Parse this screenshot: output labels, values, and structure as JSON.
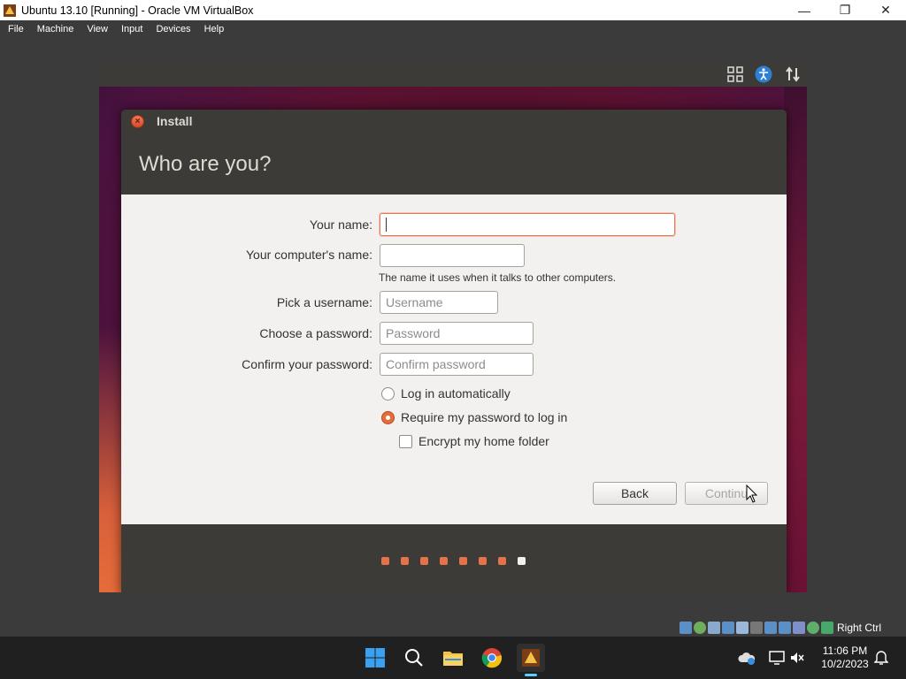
{
  "window": {
    "title": "Ubuntu 13.10 [Running] - Oracle VM VirtualBox",
    "minimize": "—",
    "maximize": "❐",
    "close": "✕"
  },
  "menu": [
    "File",
    "Machine",
    "View",
    "Input",
    "Devices",
    "Help"
  ],
  "dialog": {
    "window_title": "Install",
    "heading": "Who are you?",
    "fields": {
      "name": {
        "label": "Your name:",
        "value": ""
      },
      "computer": {
        "label": "Your computer's name:",
        "value": "",
        "hint": "The name it uses when it talks to other computers."
      },
      "username": {
        "label": "Pick a username:",
        "placeholder": "Username"
      },
      "password": {
        "label": "Choose a password:",
        "placeholder": "Password"
      },
      "confirm": {
        "label": "Confirm your password:",
        "placeholder": "Confirm password"
      }
    },
    "options": {
      "auto_login": {
        "label": "Log in automatically",
        "selected": false
      },
      "require_password": {
        "label": "Require my password to log in",
        "selected": true
      },
      "encrypt_home": {
        "label": "Encrypt my home folder",
        "checked": false
      }
    },
    "buttons": {
      "back": "Back",
      "continue": "Continu"
    },
    "progress": {
      "total_steps": 8,
      "current_step": 8
    }
  },
  "vm_status": {
    "host_key": "Right Ctrl"
  },
  "taskbar": {
    "time": "11:06 PM",
    "date": "10/2/2023"
  },
  "colors": {
    "accent": "#e4724a",
    "dialog_dark": "#3c3b37",
    "panel": "#f2f1f0"
  }
}
